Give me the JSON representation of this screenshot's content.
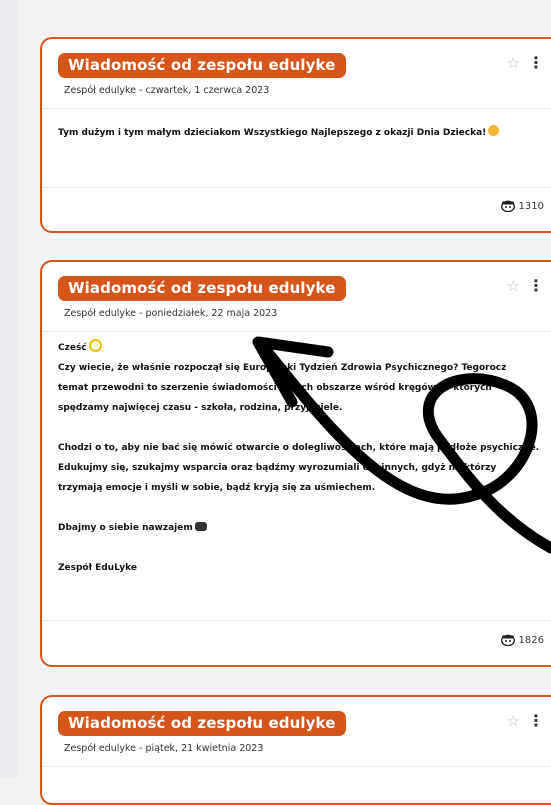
{
  "posts": [
    {
      "title": "Wiadomość od zespołu edulyke",
      "subtitle": "Zespół edulyke - czwartek, 1 czerwca 2023",
      "lines": [
        "Tym dużym i tym małym dzieciakom Wszystkiego Najlepszego z okazji Dnia Dziecka!"
      ],
      "views": "1310"
    },
    {
      "title": "Wiadomość od zespołu edulyke",
      "subtitle": "Zespół edulyke - poniedziałek, 22 maja 2023",
      "lines": [
        "Cześć",
        "Czy wiecie, że właśnie rozpoczął się Europejski Tydzień Zdrowia Psychicznego? Tegorocz",
        "temat przewodni to szerzenie świadomości w tych obszarze wśród kręgów, w których",
        "spędzamy najwięcej czasu - szkoła, rodzina, przyjaciele.",
        "",
        "Chodzi o to, aby nie bać się mówić otwarcie o dolegliwościach, które mają podłoże psychiczne.",
        "Edukujmy się, szukajmy wsparcia oraz bądźmy wyrozumiali dla innych, gdyż niektórzy",
        "trzymają emocje i myśli w sobie, bądź kryją się za uśmiechem.",
        "",
        "Dbajmy o siebie nawzajem",
        "",
        "Zespół EduLyke"
      ],
      "views": "1826"
    },
    {
      "title": "Wiadomość od zespołu edulyke",
      "subtitle": "Zespół edulyke - piątek, 21 kwietnia 2023"
    }
  ],
  "icons": {
    "star": "☆",
    "menu": "⋮",
    "views_icon": "eye-face-icon"
  },
  "colors": {
    "accent": "#d4561a",
    "background": "#f3f3f6"
  }
}
